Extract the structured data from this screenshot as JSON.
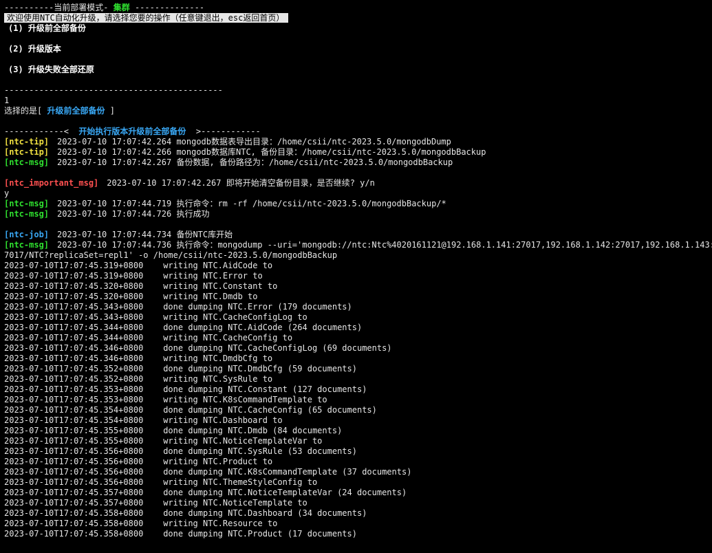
{
  "header": {
    "dashes_left": "----------",
    "mode_label": "当前部署模式- ",
    "mode_value": "集群",
    "dashes_right": " --------------",
    "banner": "欢迎使用NTC自动化升级，请选择您要的操作（任意键退出，esc返回首页）"
  },
  "menu": {
    "items": [
      "(1) 升级前全部备份",
      "(2) 升级版本",
      "(3) 升级失败全部还原"
    ]
  },
  "divider": "--------------------------------------------",
  "input": {
    "typed": "1",
    "selected_prefix": "选择的是[ ",
    "selected_value": "升级前全部备份",
    "selected_suffix": " ]"
  },
  "section": {
    "left": "------------<  ",
    "title": "开始执行版本升级前全部备份",
    "right": "  >------------"
  },
  "logs": [
    {
      "tag": "[ntc-tip]",
      "color": "yellow",
      "ts": "2023-07-10 17:07:42.264",
      "msg": "mongodb数据表导出目录：/home/csii/ntc-2023.5.0/mongodbDump"
    },
    {
      "tag": "[ntc-tip]",
      "color": "yellow",
      "ts": "2023-07-10 17:07:42.266",
      "msg": "mongodb数据库NTC, 备份目录：/home/csii/ntc-2023.5.0/mongodbBackup"
    },
    {
      "tag": "[ntc-msg]",
      "color": "green",
      "ts": "2023-07-10 17:07:42.267",
      "msg": "备份数据, 备份路径为：/home/csii/ntc-2023.5.0/mongodbBackup"
    }
  ],
  "important": {
    "tag": "[ntc_important_msg]",
    "ts": "2023-07-10 17:07:42.267",
    "msg": "即将开始清空备份目录，是否继续? y/n",
    "answer": "y"
  },
  "logs2": [
    {
      "tag": "[ntc-msg]",
      "color": "green",
      "ts": "2023-07-10 17:07:44.719",
      "msg": "执行命令：rm -rf /home/csii/ntc-2023.5.0/mongodbBackup/*"
    },
    {
      "tag": "[ntc-msg]",
      "color": "green",
      "ts": "2023-07-10 17:07:44.726",
      "msg": "执行成功"
    }
  ],
  "logs3": [
    {
      "tag": "[ntc-job]",
      "color": "cyan",
      "ts": "2023-07-10 17:07:44.734",
      "msg": "备份NTC库开始"
    },
    {
      "tag": "[ntc-msg]",
      "color": "green",
      "ts": "2023-07-10 17:07:44.736",
      "msg": "执行命令：mongodump --uri='mongodb://ntc:Ntc%4020161121@192.168.1.141:27017,192.168.1.142:27017,192.168.1.143:2"
    }
  ],
  "cmd_continuation": "7017/NTC?replicaSet=repl1' -o /home/csii/ntc-2023.5.0/mongodbBackup",
  "dump_lines": [
    {
      "ts": "2023-07-10T17:07:45.319+0800",
      "text": "writing NTC.AidCode to"
    },
    {
      "ts": "2023-07-10T17:07:45.319+0800",
      "text": "writing NTC.Error to"
    },
    {
      "ts": "2023-07-10T17:07:45.320+0800",
      "text": "writing NTC.Constant to"
    },
    {
      "ts": "2023-07-10T17:07:45.320+0800",
      "text": "writing NTC.Dmdb to"
    },
    {
      "ts": "2023-07-10T17:07:45.343+0800",
      "text": "done dumping NTC.Error (179 documents)"
    },
    {
      "ts": "2023-07-10T17:07:45.343+0800",
      "text": "writing NTC.CacheConfigLog to"
    },
    {
      "ts": "2023-07-10T17:07:45.344+0800",
      "text": "done dumping NTC.AidCode (264 documents)"
    },
    {
      "ts": "2023-07-10T17:07:45.344+0800",
      "text": "writing NTC.CacheConfig to"
    },
    {
      "ts": "2023-07-10T17:07:45.346+0800",
      "text": "done dumping NTC.CacheConfigLog (69 documents)"
    },
    {
      "ts": "2023-07-10T17:07:45.346+0800",
      "text": "writing NTC.DmdbCfg to"
    },
    {
      "ts": "2023-07-10T17:07:45.352+0800",
      "text": "done dumping NTC.DmdbCfg (59 documents)"
    },
    {
      "ts": "2023-07-10T17:07:45.352+0800",
      "text": "writing NTC.SysRule to"
    },
    {
      "ts": "2023-07-10T17:07:45.353+0800",
      "text": "done dumping NTC.Constant (127 documents)"
    },
    {
      "ts": "2023-07-10T17:07:45.353+0800",
      "text": "writing NTC.K8sCommandTemplate to"
    },
    {
      "ts": "2023-07-10T17:07:45.354+0800",
      "text": "done dumping NTC.CacheConfig (65 documents)"
    },
    {
      "ts": "2023-07-10T17:07:45.354+0800",
      "text": "writing NTC.Dashboard to"
    },
    {
      "ts": "2023-07-10T17:07:45.355+0800",
      "text": "done dumping NTC.Dmdb (84 documents)"
    },
    {
      "ts": "2023-07-10T17:07:45.355+0800",
      "text": "writing NTC.NoticeTemplateVar to"
    },
    {
      "ts": "2023-07-10T17:07:45.356+0800",
      "text": "done dumping NTC.SysRule (53 documents)"
    },
    {
      "ts": "2023-07-10T17:07:45.356+0800",
      "text": "writing NTC.Product to"
    },
    {
      "ts": "2023-07-10T17:07:45.356+0800",
      "text": "done dumping NTC.K8sCommandTemplate (37 documents)"
    },
    {
      "ts": "2023-07-10T17:07:45.356+0800",
      "text": "writing NTC.ThemeStyleConfig to"
    },
    {
      "ts": "2023-07-10T17:07:45.357+0800",
      "text": "done dumping NTC.NoticeTemplateVar (24 documents)"
    },
    {
      "ts": "2023-07-10T17:07:45.357+0800",
      "text": "writing NTC.NoticeTemplate to"
    },
    {
      "ts": "2023-07-10T17:07:45.358+0800",
      "text": "done dumping NTC.Dashboard (34 documents)"
    },
    {
      "ts": "2023-07-10T17:07:45.358+0800",
      "text": "writing NTC.Resource to"
    },
    {
      "ts": "2023-07-10T17:07:45.358+0800",
      "text": "done dumping NTC.Product (17 documents)"
    }
  ],
  "colors": {
    "background": "#000000",
    "text": "#e6e6e6",
    "green": "#2fe02f",
    "yellow": "#f0e040",
    "cyan": "#39a8f5",
    "red": "#ff5050"
  }
}
